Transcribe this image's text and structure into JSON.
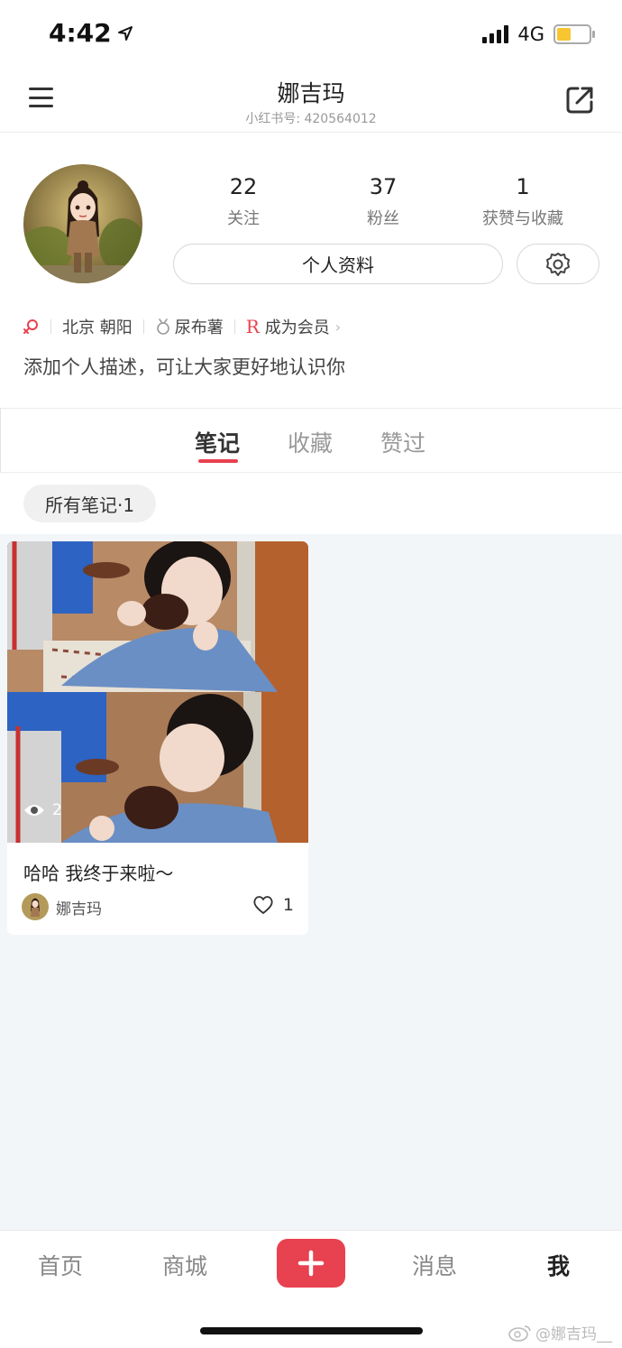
{
  "status_bar": {
    "time": "4:42",
    "network": "4G",
    "battery_level": 0.45,
    "signal_bars": 4
  },
  "nav": {
    "title": "娜吉玛",
    "subtitle": "小红书号: 420564012"
  },
  "profile": {
    "stats": [
      {
        "value": "22",
        "label": "关注"
      },
      {
        "value": "37",
        "label": "粉丝"
      },
      {
        "value": "1",
        "label": "获赞与收藏"
      }
    ],
    "edit_label": "个人资料",
    "tags": {
      "location": "北京 朝阳",
      "badge": "尿布薯",
      "member": "成为会员"
    },
    "bio": "添加个人描述，可让大家更好地认识你"
  },
  "tabs": [
    {
      "label": "笔记",
      "active": true
    },
    {
      "label": "收藏",
      "active": false
    },
    {
      "label": "赞过",
      "active": false
    }
  ],
  "filter_chip": "所有笔记·1",
  "note_card": {
    "views": "2",
    "title": "哈哈 我终于来啦～",
    "author": "娜吉玛",
    "likes": "1"
  },
  "bottom_nav": {
    "home": "首页",
    "shop": "商城",
    "messages": "消息",
    "me": "我"
  },
  "watermark": "@娜吉玛__",
  "colors": {
    "accent": "#e8414f",
    "feed_bg": "#f3f6f9"
  }
}
